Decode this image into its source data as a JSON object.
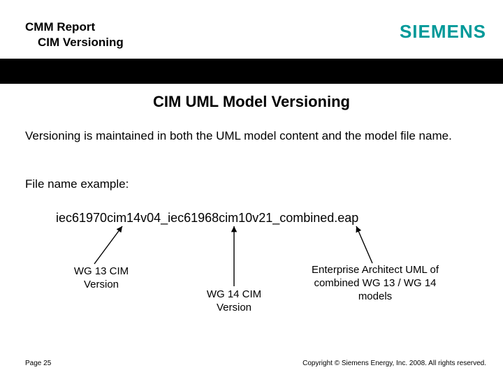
{
  "header": {
    "line1": "CMM Report",
    "line2": "CIM Versioning",
    "logo": "SIEMENS"
  },
  "title": "CIM UML Model Versioning",
  "body": {
    "p1": "Versioning is maintained in both the UML model content and the model file name.",
    "p2": "File name example:",
    "filename": "iec61970cim14v04_iec61968cim10v21_combined.eap"
  },
  "labels": {
    "l1": "WG 13 CIM Version",
    "l2": "WG 14 CIM Version",
    "l3": "Enterprise Architect UML of combined WG 13 / WG 14 models"
  },
  "footer": {
    "page": "Page 25",
    "copyright": "Copyright © Siemens Energy, Inc. 2008. All rights reserved."
  }
}
